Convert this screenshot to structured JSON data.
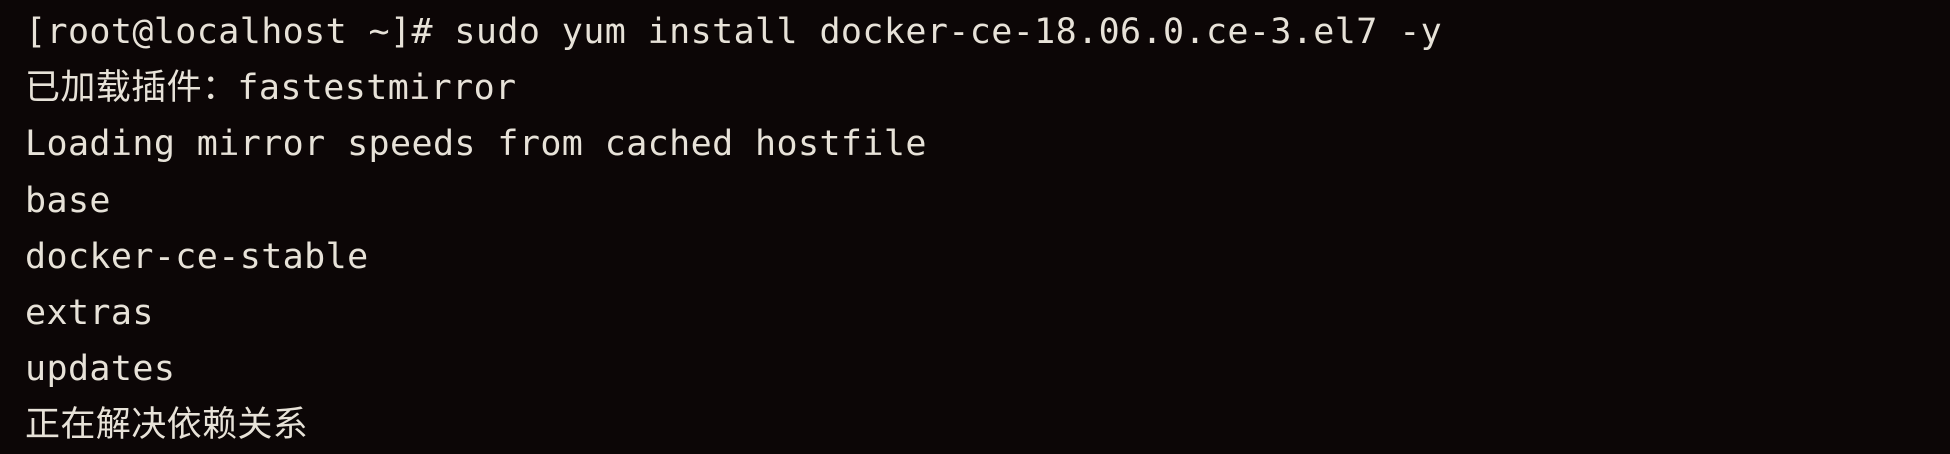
{
  "terminal": {
    "lines": [
      "[root@localhost ~]# sudo yum install docker-ce-18.06.0.ce-3.el7 -y",
      "已加载插件：fastestmirror",
      "Loading mirror speeds from cached hostfile",
      "base",
      "docker-ce-stable",
      "extras",
      "updates",
      "正在解决依赖关系"
    ]
  },
  "colors": {
    "background": "#0c0606",
    "text": "#e7e2d8"
  }
}
